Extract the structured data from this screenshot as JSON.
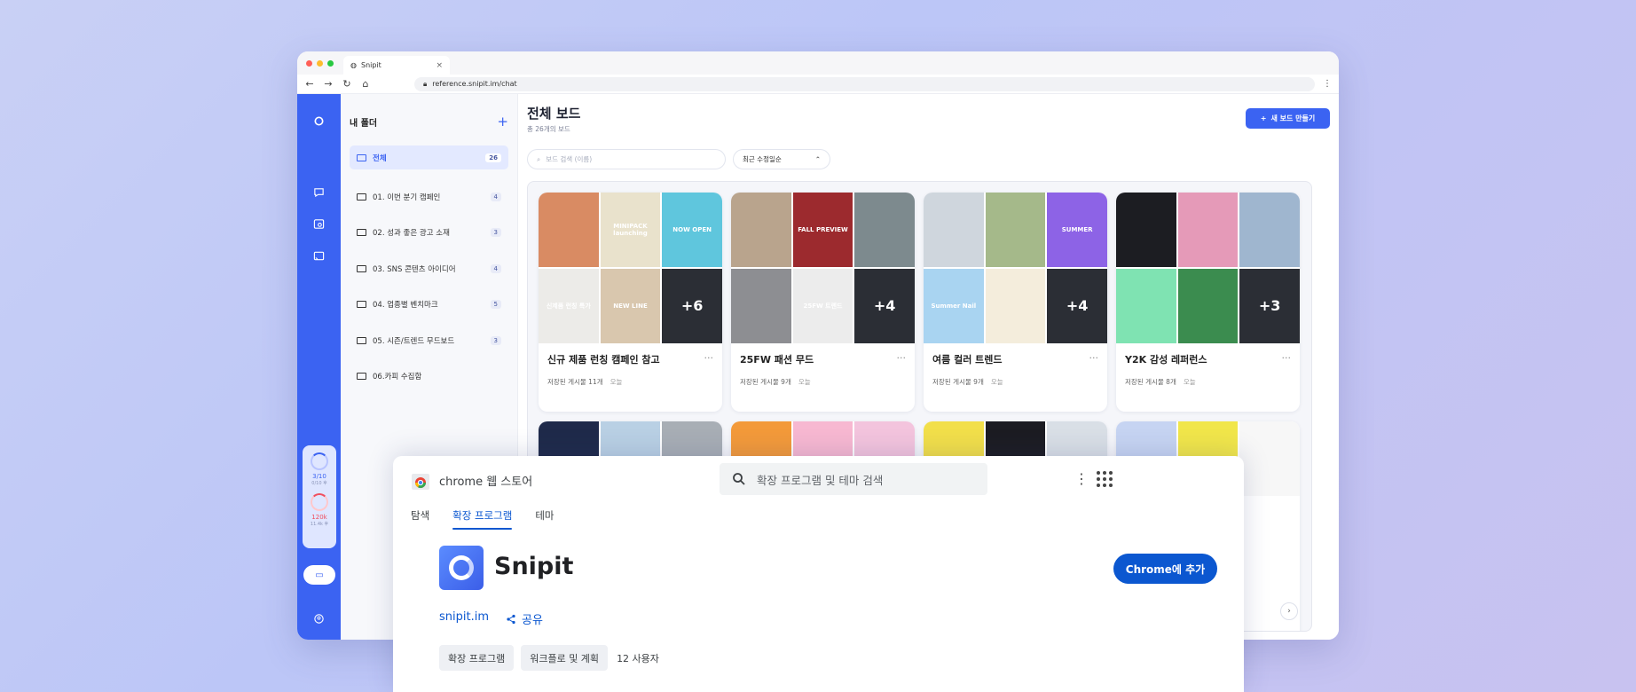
{
  "browser": {
    "tab_title": "Snipit",
    "tab_close": "×",
    "url": "reference.snipit.im/chat"
  },
  "sidebar": {
    "title": "내 폴더",
    "add": "+",
    "folders": [
      {
        "label": "전체",
        "count": "26",
        "active": true
      },
      {
        "label": "01. 이번 분기 캠페인",
        "count": "4"
      },
      {
        "label": "02. 성과 좋은 광고 소재",
        "count": "3"
      },
      {
        "label": "03. SNS 콘텐츠 아이디어",
        "count": "4"
      },
      {
        "label": "04. 업종별 벤치마크",
        "count": "5"
      },
      {
        "label": "05. 시즌/트렌드 무드보드",
        "count": "3"
      },
      {
        "label": "06.카피 수집함",
        "count": ""
      }
    ]
  },
  "rail": {
    "usage_a": "3/10",
    "usage_a_sub": "0/10 후",
    "usage_b": "120k",
    "usage_b_sub": "11.4k 후"
  },
  "main": {
    "title": "전체 보드",
    "subtitle": "총 26개의 보드",
    "new_board": "새 보드 만들기",
    "search_placeholder": "보드 검색 (이름)",
    "sort": "최근 수정일순",
    "pager_next": "›",
    "cards": [
      {
        "title": "신규 제품 런칭 캠페인 참고",
        "meta": "저장된 게시물 11개",
        "when": "오늘",
        "more": "+6",
        "thumbs": [
          {
            "bg": "#d98b63",
            "text": ""
          },
          {
            "bg": "#e9e2cc",
            "text": "MINIPACK launching"
          },
          {
            "bg": "#5fc6dd",
            "text": "NOW OPEN"
          },
          {
            "bg": "#ecebe8",
            "text": "신제품 런칭 특가"
          },
          {
            "bg": "#d9c7ae",
            "text": "NEW LINE"
          }
        ]
      },
      {
        "title": "25FW 패션 무드",
        "meta": "저장된 게시물 9개",
        "when": "오늘",
        "more": "+4",
        "thumbs": [
          {
            "bg": "#b9a48d",
            "text": ""
          },
          {
            "bg": "#9c2a2e",
            "text": "FALL PREVIEW"
          },
          {
            "bg": "#7d8a8e",
            "text": ""
          },
          {
            "bg": "#8d8e92",
            "text": ""
          },
          {
            "bg": "#ececec",
            "text": "25FW 트렌드"
          }
        ]
      },
      {
        "title": "여름 컬러 트렌드",
        "meta": "저장된 게시물 9개",
        "when": "오늘",
        "more": "+4",
        "thumbs": [
          {
            "bg": "#cfd6dd",
            "text": ""
          },
          {
            "bg": "#a5b98a",
            "text": ""
          },
          {
            "bg": "#8d63e6",
            "text": "SUMMER"
          },
          {
            "bg": "#a9d4f1",
            "text": "Summer Nail"
          },
          {
            "bg": "#f4eddc",
            "text": ""
          }
        ]
      },
      {
        "title": "Y2K 감성 레퍼런스",
        "meta": "저장된 게시물 8개",
        "when": "오늘",
        "more": "+3",
        "thumbs": [
          {
            "bg": "#1c1d22",
            "text": ""
          },
          {
            "bg": "#e59ab8",
            "text": ""
          },
          {
            "bg": "#9fb6cf",
            "text": ""
          },
          {
            "bg": "#7fe3b2",
            "text": ""
          },
          {
            "bg": "#3b8c4f",
            "text": ""
          }
        ]
      }
    ],
    "row2": [
      {
        "bg": [
          "#1f2a4a",
          "#b9d0e4",
          "#a8aeb5"
        ]
      },
      {
        "bg": [
          "#f39a3a",
          "#f7b8d1",
          "#f3c4dd"
        ]
      },
      {
        "bg": [
          "#f2df4a",
          "#1c1c22",
          "#d9dfe6"
        ]
      },
      {
        "bg": [
          "#c6d4f2",
          "#f1e64a",
          "#f7f7f7"
        ]
      }
    ]
  },
  "store": {
    "name": "chrome 웹 스토어",
    "search_placeholder": "확장 프로그램 및 테마 검색",
    "tabs": [
      {
        "label": "탐색"
      },
      {
        "label": "확장 프로그램",
        "active": true
      },
      {
        "label": "테마"
      }
    ],
    "ext_name": "Snipit",
    "add_button": "Chrome에 추가",
    "site": "snipit.im",
    "share": "공유",
    "chips": [
      "확장 프로그램",
      "워크플로 및 계획"
    ],
    "users": "12 사용자"
  },
  "colors": {
    "accent": "#3b63f2",
    "google_blue": "#0b57d0"
  }
}
